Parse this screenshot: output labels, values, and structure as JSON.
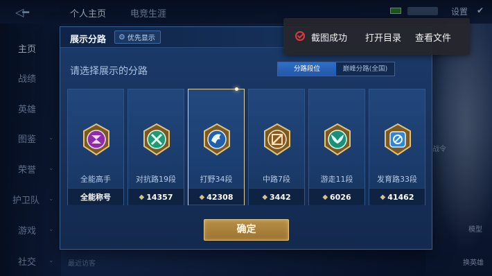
{
  "topbar": {
    "tabs": [
      "个人主页",
      "电竞生涯"
    ],
    "settings_label": "设置"
  },
  "sidebar": {
    "items": [
      "主页",
      "战绩",
      "英雄",
      "图鉴",
      "荣誉",
      "护卫队",
      "游戏",
      "社交"
    ]
  },
  "background": {
    "recent_visitors": "最近访客",
    "right_labels": [
      "战令",
      "模型",
      "换英雄"
    ]
  },
  "modal": {
    "title": "展示分路",
    "priority_button": "优先显示",
    "prompt": "请选择展示的分路",
    "segments": [
      "分路段位",
      "巅峰分路(全国)"
    ],
    "active_segment": 0,
    "confirm_label": "确定",
    "cards": [
      {
        "label": "全能高手",
        "footer": "全能称号",
        "has_points": false,
        "emblem": "purple-ring-emblem",
        "color": "#c24fd6",
        "selected": false
      },
      {
        "label": "对抗路19段",
        "footer": "14357",
        "has_points": true,
        "emblem": "green-cross-emblem",
        "color": "#2fbf8c",
        "selected": false
      },
      {
        "label": "打野34段",
        "footer": "42308",
        "has_points": true,
        "emblem": "blue-dragon-emblem",
        "color": "#3b8fe0",
        "selected": true
      },
      {
        "label": "中路7段",
        "footer": "3442",
        "has_points": true,
        "emblem": "bronze-slash-emblem",
        "color": "#c98a3a",
        "selected": false
      },
      {
        "label": "游走11段",
        "footer": "6026",
        "has_points": true,
        "emblem": "teal-wings-emblem",
        "color": "#2cb39a",
        "selected": false
      },
      {
        "label": "发育路33段",
        "footer": "41462",
        "has_points": true,
        "emblem": "lightblue-target-emblem",
        "color": "#4aa3e8",
        "selected": false
      }
    ]
  },
  "toast": {
    "message": "截图成功",
    "open_folder": "打开目录",
    "view_file": "查看文件",
    "icon": "check-circle-icon",
    "icon_color": "#e0393e"
  }
}
